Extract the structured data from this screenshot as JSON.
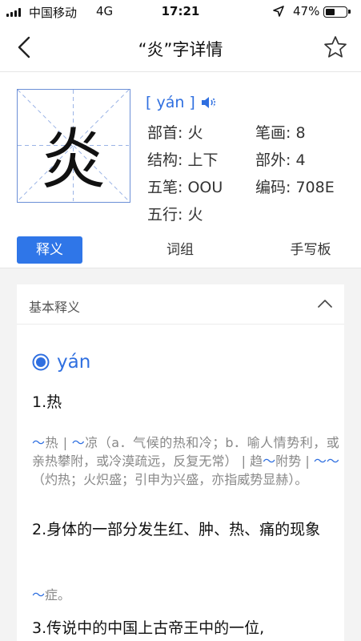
{
  "status_bar": {
    "carrier": "中国移动",
    "network": "4G",
    "time": "17:21",
    "battery_percent": "47%",
    "battery_level": 0.47
  },
  "nav": {
    "title": "“炎”字详情",
    "back_icon": "chevron-left-icon",
    "favorite_icon": "star-outline-icon"
  },
  "character": {
    "glyph": "炎",
    "pinyin": "[ yán ]",
    "speaker_icon": "speaker-icon",
    "radical": "部首: 火",
    "strokes": "笔画: 8",
    "structure": "结构: 上下",
    "outside_strokes": "部外: 4",
    "wubi": "五笔: OOU",
    "code": "编码: 708E",
    "five_elements": "五行: 火"
  },
  "tabs": [
    {
      "label": "释义",
      "active": true
    },
    {
      "label": "词组",
      "active": false
    },
    {
      "label": "手写板",
      "active": false
    }
  ],
  "definition": {
    "section_title": "基本释义",
    "pinyin": "yán",
    "items": [
      {
        "heading": "1.热",
        "example_pre": "",
        "example": "～热 | ～凉（a．气候的热和冷；b．喻人情势利，或亲热攀附，或冷漠疏远，反复无常） | 趋～附势 | ～～（灼热；火炽盛；引申为兴盛，亦指威势显赫）。"
      },
      {
        "heading": "2.身体的一部分发生红、肿、热、痛的现象",
        "example": "～症。"
      },
      {
        "heading": "3.传说中的中国上古帝王中的一位,"
      }
    ]
  },
  "colors": {
    "accent": "#2f76e8",
    "link_blue": "#2f6fe0",
    "gray_text": "#888888",
    "content_bg": "#f3f3f3"
  }
}
